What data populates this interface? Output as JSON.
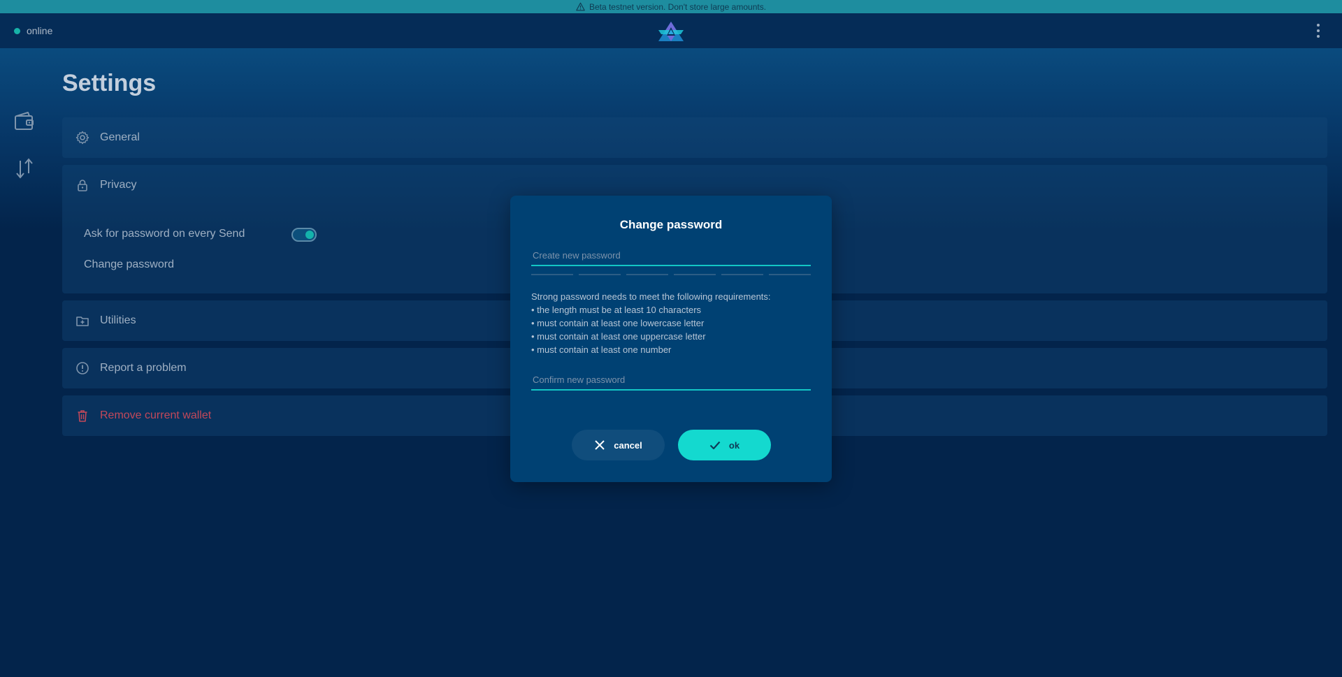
{
  "banner": {
    "text": "Beta testnet version. Don't store large amounts.",
    "icon": "warning-icon"
  },
  "topbar": {
    "status_text": "online",
    "status_color": "#17b3a8",
    "logo": "logo-icon",
    "menu_icon": "kebab-menu-icon"
  },
  "sidebar": {
    "items": [
      {
        "icon": "wallet-icon"
      },
      {
        "icon": "transfer-arrows-icon"
      }
    ]
  },
  "page": {
    "title": "Settings"
  },
  "sections": {
    "general": {
      "label": "General",
      "icon": "gear-icon"
    },
    "privacy": {
      "label": "Privacy",
      "icon": "lock-icon",
      "ask_password_label": "Ask for password on every Send",
      "ask_password_enabled": true,
      "change_password_label": "Change password"
    },
    "utilities": {
      "label": "Utilities",
      "icon": "folder-plus-icon"
    },
    "report": {
      "label": "Report a problem",
      "icon": "alert-circle-icon"
    },
    "remove": {
      "label": "Remove current wallet",
      "icon": "trash-icon",
      "color": "#c2485a"
    }
  },
  "modal": {
    "title": "Change password",
    "new_password_placeholder": "Create new password",
    "new_password_value": "",
    "requirements_intro": "Strong password needs to meet the following requirements:",
    "requirements": [
      "• the length must be at least 10 characters",
      "• must contain at least one lowercase letter",
      "• must contain at least one uppercase letter",
      "• must contain at least one number"
    ],
    "confirm_password_placeholder": "Confirm new password",
    "confirm_password_value": "",
    "cancel_label": "cancel",
    "ok_label": "ok",
    "accent_color": "#14d9cf"
  }
}
